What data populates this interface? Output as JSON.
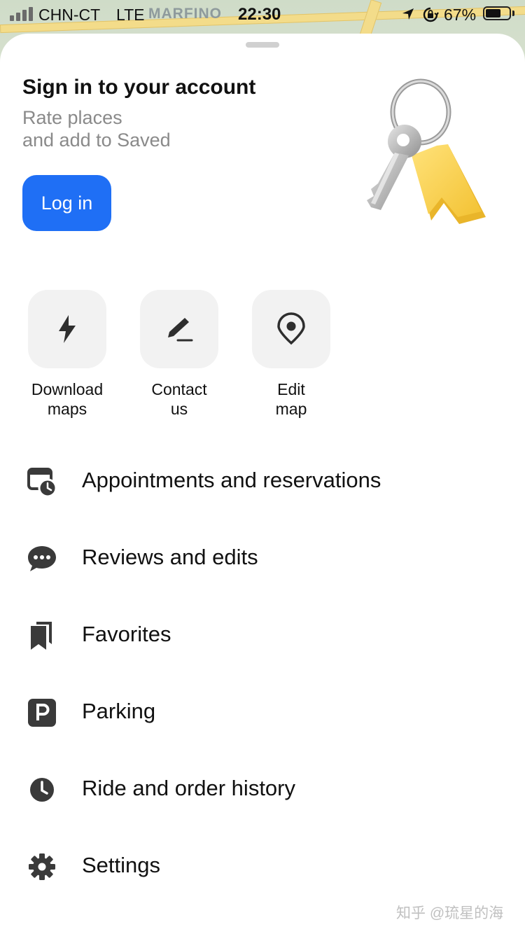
{
  "status_bar": {
    "carrier": "CHN-CT",
    "network": "LTE",
    "time": "22:30",
    "battery_percent": "67%",
    "battery_level": 0.67,
    "icons": [
      "signal-icon",
      "location-arrow-icon",
      "rotation-lock-icon",
      "battery-icon"
    ]
  },
  "map": {
    "label": "MARFINO"
  },
  "signin": {
    "title": "Sign in to your account",
    "subtitle_line1": "Rate places",
    "subtitle_line2": "and add to Saved",
    "login_label": "Log in",
    "illustration": "keys-icon"
  },
  "quick_actions": [
    {
      "line1": "Download",
      "line2": "maps",
      "icon": "lightning-icon"
    },
    {
      "line1": "Contact",
      "line2": "us",
      "icon": "pen-icon"
    },
    {
      "line1": "Edit",
      "line2": "map",
      "icon": "map-pin-icon"
    }
  ],
  "menu": [
    {
      "label": "Appointments and reservations",
      "icon": "calendar-clock-icon"
    },
    {
      "label": "Reviews and edits",
      "icon": "chat-bubble-icon"
    },
    {
      "label": "Favorites",
      "icon": "bookmarks-icon"
    },
    {
      "label": "Parking",
      "icon": "parking-icon"
    },
    {
      "label": "Ride and order history",
      "icon": "clock-icon"
    },
    {
      "label": "Settings",
      "icon": "gear-icon"
    }
  ],
  "watermark": "知乎 @琉星的海",
  "colors": {
    "accent": "#1f6ff5",
    "text_primary": "#111111",
    "text_secondary": "#8a8a8a",
    "tile_bg": "#f2f2f2",
    "icon": "#3a3a3a"
  }
}
